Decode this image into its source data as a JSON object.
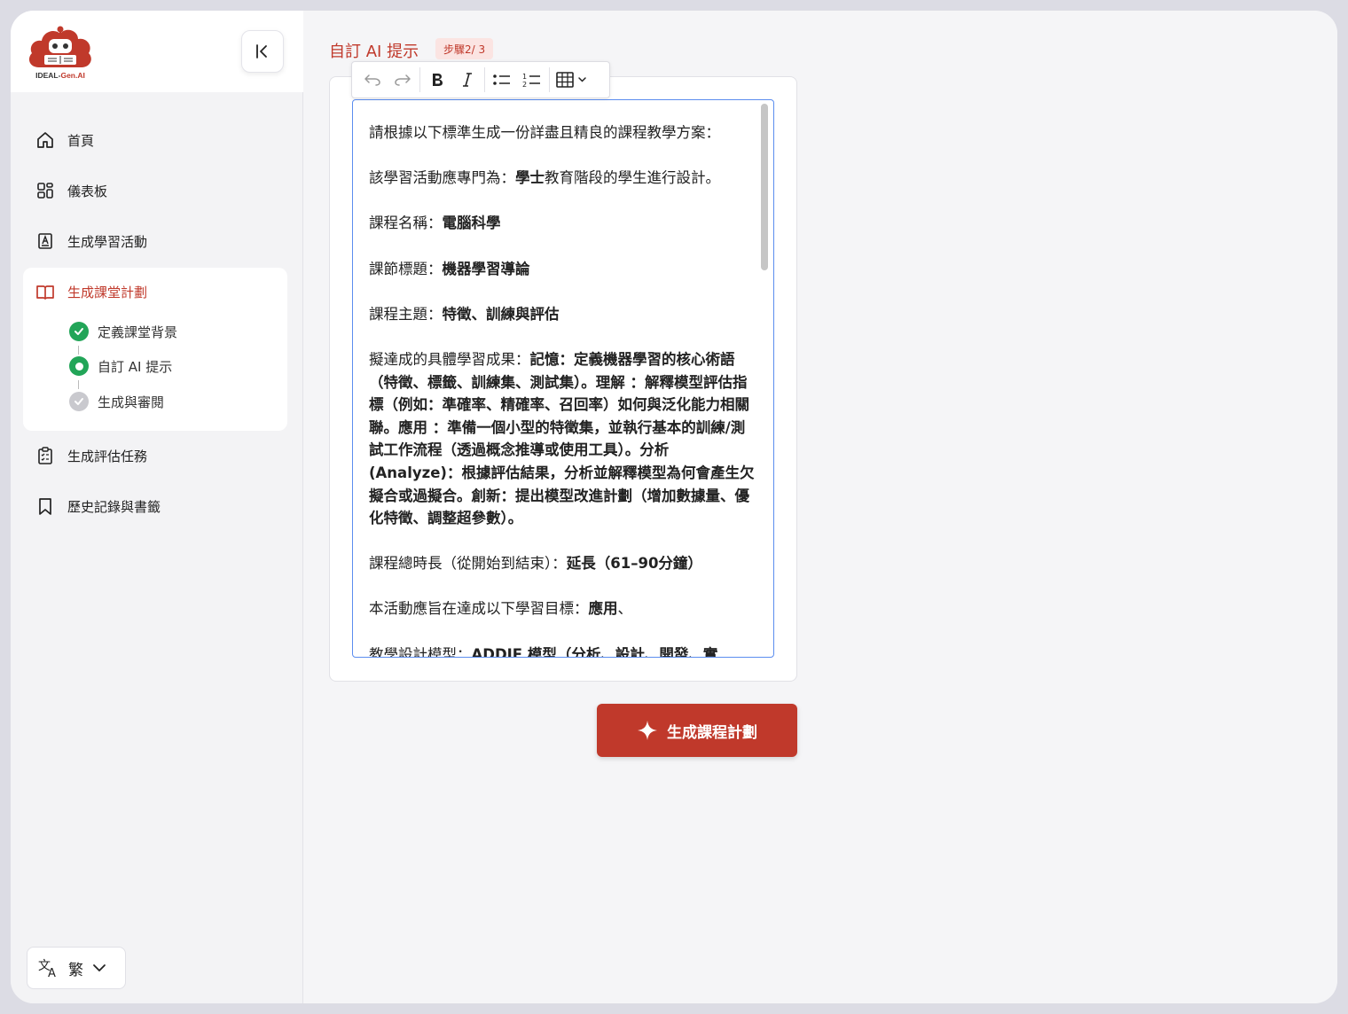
{
  "brand": {
    "name_prefix": "IDEAL-",
    "name_accent": "Gen.AI",
    "accent": "#c0392b"
  },
  "sidebar": {
    "items": [
      {
        "label": "首頁",
        "icon": "home-icon"
      },
      {
        "label": "儀表板",
        "icon": "dashboard-icon"
      },
      {
        "label": "生成學習活動",
        "icon": "activity-icon"
      },
      {
        "label": "生成課堂計劃",
        "icon": "book-icon",
        "active": true
      },
      {
        "label": "生成評估任務",
        "icon": "clipboard-icon"
      },
      {
        "label": "歷史記錄與書籤",
        "icon": "bookmark-icon"
      }
    ],
    "steps": [
      {
        "label": "定義課堂背景",
        "state": "done"
      },
      {
        "label": "自訂 AI 提示",
        "state": "current"
      },
      {
        "label": "生成與審閱",
        "state": "pending"
      }
    ],
    "language": "繁"
  },
  "main": {
    "title": "自訂 AI 提示",
    "step_badge": "步驟2/ 3",
    "editor": {
      "p1": "請根據以下標準生成一份詳盡且精良的課程教學方案：",
      "p2_label": "該學習活動應專門為：",
      "p2_value": "學士",
      "p2_tail": "教育階段的學生進行設計。",
      "p3_label": "課程名稱：",
      "p3_value": "電腦科學",
      "p4_label": "課節標題：",
      "p4_value": "機器學習導論",
      "p5_label": "課程主題：",
      "p5_value": "特徵、訓練與評估",
      "p6_label": "擬達成的具體學習成果：",
      "p6_value": "記憶：定義機器學習的核心術語（特徵、標籤、訓練集、測試集）。理解 ：解釋模型評估指標（例如：準確率、精確率、召回率）如何與泛化能力相關聯。應用 ：準備一個小型的特徵集，並執行基本的訓練/測試工作流程（透過概念推導或使用工具）。分析 (Analyze)：根據評估結果，分析並解釋模型為何會產生欠擬合或過擬合。創新：提出模型改進計劃（增加數據量、優化特徵、調整超參數）。",
      "p7_label": "課程總時長（從開始到結束）：",
      "p7_value": "延長（61–90分鐘）",
      "p8_label": "本活動應旨在達成以下學習目標：",
      "p8_value": "應用",
      "p8_tail": "、",
      "p9_label": "教學設計模型：",
      "p9_value": "ADDIE 模型（分析、設計、開發、實"
    },
    "generate_button": "生成課程計劃"
  }
}
